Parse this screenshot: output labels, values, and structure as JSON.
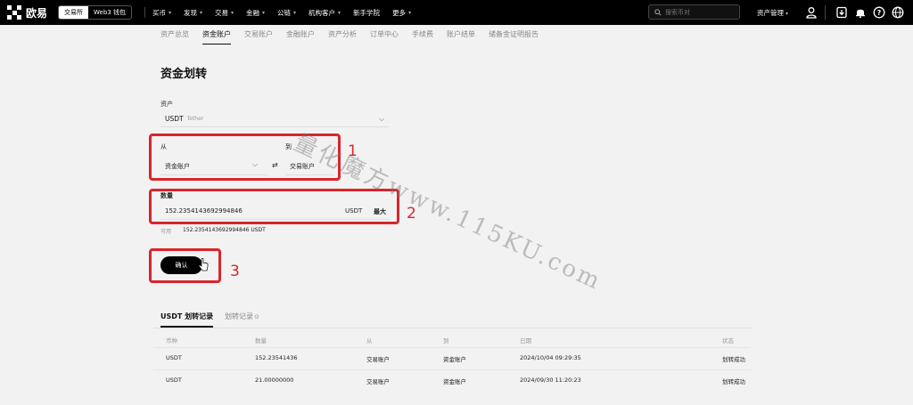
{
  "header": {
    "logo_text": "欧易",
    "mode_exchange": "交易所",
    "mode_web3": "Web3 钱包",
    "nav": [
      "买币",
      "发现",
      "交易",
      "金融",
      "公链",
      "机构客户",
      "新手学院",
      "更多"
    ],
    "nav_has_caret": [
      true,
      true,
      true,
      true,
      true,
      true,
      false,
      true
    ],
    "search_placeholder": "搜索币对",
    "asset_management": "资产管理"
  },
  "subnav": {
    "tabs": [
      "资产总览",
      "资金账户",
      "交易账户",
      "金融账户",
      "资产分析",
      "订单中心",
      "手续费",
      "账户结单",
      "储备金证明报告"
    ],
    "active_index": 1
  },
  "form": {
    "title": "资金划转",
    "asset_label": "资产",
    "asset_code": "USDT",
    "asset_name": "Tether",
    "from_label": "从",
    "to_label": "到",
    "from_account": "资金账户",
    "swap_symbol": "⇄",
    "to_account": "交易账户",
    "amount_label": "数量",
    "amount_value": "152.2354143692994846",
    "amount_unit": "USDT",
    "max_label": "最大",
    "available_label": "可用",
    "available_value": "152.2354143692994846 USDT",
    "confirm_label": "确认"
  },
  "annotations": {
    "step1": "1",
    "step2": "2",
    "step3": "3",
    "watermark": "量化魔方www.115KU.com"
  },
  "records": {
    "tab_active": "USDT 划转记录",
    "tab_all": "划转记录",
    "tab_all_icon": "circle-arrow-icon",
    "columns": [
      "币种",
      "数量",
      "从",
      "到",
      "日期",
      "状态"
    ],
    "rows": [
      [
        "USDT",
        "152.23541436",
        "交易账户",
        "资金账户",
        "2024/10/04 09:29:35",
        "划转成功"
      ],
      [
        "USDT",
        "21.00000000",
        "交易账户",
        "资金账户",
        "2024/09/30 11:20:23",
        "划转成功"
      ]
    ]
  },
  "colors": {
    "annotation_red": "#d8252b",
    "topbar": "#000000",
    "background": "#f2f2f2"
  }
}
